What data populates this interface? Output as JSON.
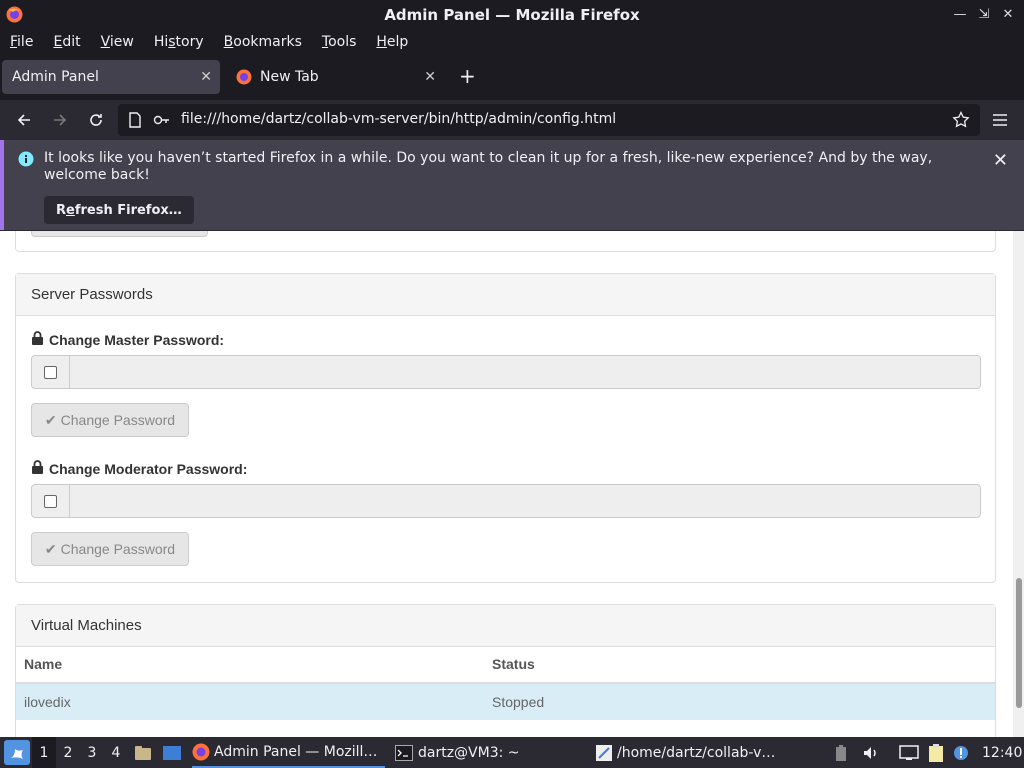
{
  "window": {
    "title": "Admin Panel — Mozilla Firefox"
  },
  "menubar": {
    "items": [
      {
        "label": "File",
        "accel": "F",
        "rest": "ile"
      },
      {
        "label": "Edit",
        "accel": "E",
        "rest": "dit"
      },
      {
        "label": "View",
        "accel": "V",
        "rest": "iew"
      },
      {
        "label": "History",
        "accel": "s",
        "pre": "Hi",
        "rest": "tory"
      },
      {
        "label": "Bookmarks",
        "accel": "B",
        "rest": "ookmarks"
      },
      {
        "label": "Tools",
        "accel": "T",
        "rest": "ools"
      },
      {
        "label": "Help",
        "accel": "H",
        "rest": "elp"
      }
    ]
  },
  "tabs": [
    {
      "label": "Admin Panel",
      "active": true
    },
    {
      "label": "New Tab",
      "active": false
    }
  ],
  "navbar": {
    "url": "file:///home/dartz/collab-vm-server/bin/http/admin/config.html"
  },
  "notification": {
    "message": "It looks like you haven’t started Firefox in a while. Do you want to clean it up for a fresh, like-new experience? And by the way, welcome back!",
    "button_accel": "e",
    "button_pre": "R",
    "button_rest": "fresh Firefox…"
  },
  "server_passwords": {
    "heading": "Server Passwords",
    "master_label": "Change Master Password:",
    "moderator_label": "Change Moderator Password:",
    "change_button": "Change Password"
  },
  "virtual_machines": {
    "heading": "Virtual Machines",
    "columns": [
      "Name",
      "Status"
    ],
    "rows": [
      {
        "name": "ilovedix",
        "status": "Stopped"
      }
    ]
  },
  "taskbar": {
    "workspaces": [
      "1",
      "2",
      "3",
      "4"
    ],
    "apps": [
      {
        "label": "Admin Panel — Mozill…",
        "active": true
      },
      {
        "label": "dartz@VM3: ~",
        "active": false
      },
      {
        "label": "/home/dartz/collab-v…",
        "active": false
      }
    ],
    "clock": "12:40"
  },
  "colors": {
    "accent": "#5294e2",
    "notice_bar": "#a472ea",
    "selected_row": "#d9edf7"
  }
}
